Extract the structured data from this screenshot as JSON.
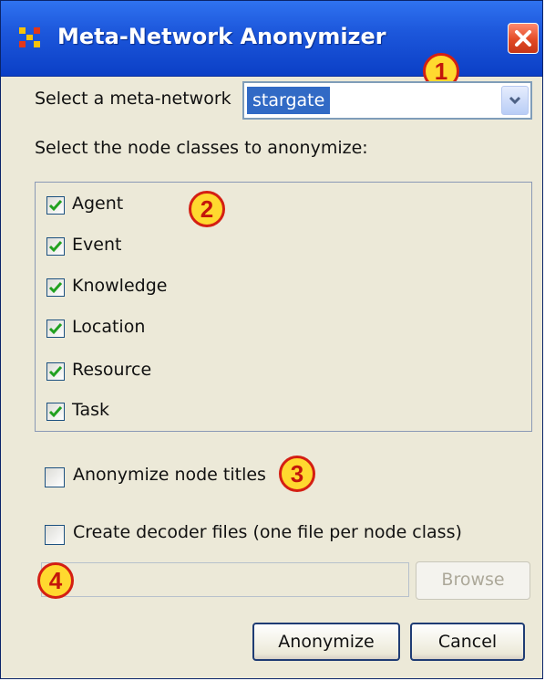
{
  "window": {
    "title": "Meta-Network Anonymizer"
  },
  "network_select": {
    "label": "Select a meta-network",
    "value": "stargate"
  },
  "node_classes": {
    "label": "Select the node classes to anonymize:",
    "items": [
      {
        "label": "Agent",
        "checked": true
      },
      {
        "label": "Event",
        "checked": true
      },
      {
        "label": "Knowledge",
        "checked": true
      },
      {
        "label": "Location",
        "checked": true
      },
      {
        "label": "Resource",
        "checked": true
      },
      {
        "label": "Task",
        "checked": true
      }
    ]
  },
  "options": {
    "anonymize_titles": {
      "label": "Anonymize node titles",
      "checked": false
    },
    "create_decoder": {
      "label": "Create decoder files (one file per node class)",
      "checked": false
    }
  },
  "decoder_path": {
    "value": ""
  },
  "buttons": {
    "browse": "Browse",
    "anonymize": "Anonymize",
    "cancel": "Cancel"
  },
  "callouts": [
    "1",
    "2",
    "3",
    "4"
  ],
  "colors": {
    "title_bar": "#1d58dc",
    "selection": "#316ac5",
    "callout_fill": "#ffd92f",
    "callout_border": "#d41f13",
    "check": "#21a121"
  }
}
